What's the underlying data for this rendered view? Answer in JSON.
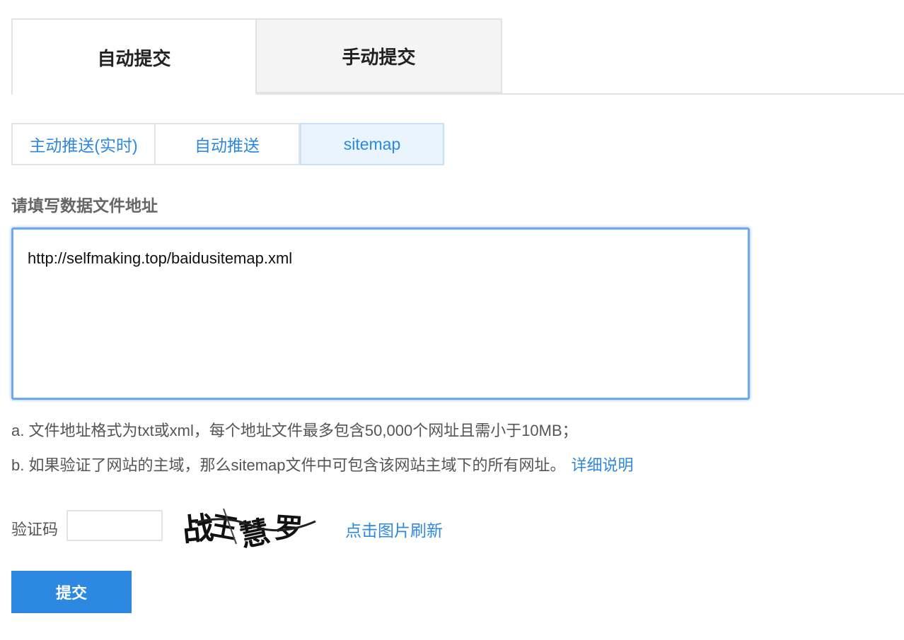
{
  "top_tabs": [
    {
      "label": "自动提交",
      "active": true
    },
    {
      "label": "手动提交",
      "active": false
    }
  ],
  "sub_tabs": [
    {
      "label": "主动推送(实时)",
      "active": false
    },
    {
      "label": "自动推送",
      "active": false
    },
    {
      "label": "sitemap",
      "active": true
    }
  ],
  "form": {
    "field_label": "请填写数据文件地址",
    "url_value": "http://selfmaking.top/baidusitemap.xml",
    "note_a": "a. 文件地址格式为txt或xml，每个地址文件最多包含50,000个网址且需小于10MB；",
    "note_b": "b. 如果验证了网站的主域，那么sitemap文件中可包含该网站主域下的所有网址。",
    "note_b_link": "详细说明",
    "captcha_label": "验证码",
    "captcha_value": "",
    "captcha_text": "战王慧罗",
    "captcha_refresh": "点击图片刷新",
    "submit_label": "提交"
  },
  "colors": {
    "accent": "#2c88e0",
    "active_subtab_bg": "#eaf4fd",
    "inactive_tab_bg": "#f4f4f4",
    "focus_border": "#6ea9ef"
  }
}
